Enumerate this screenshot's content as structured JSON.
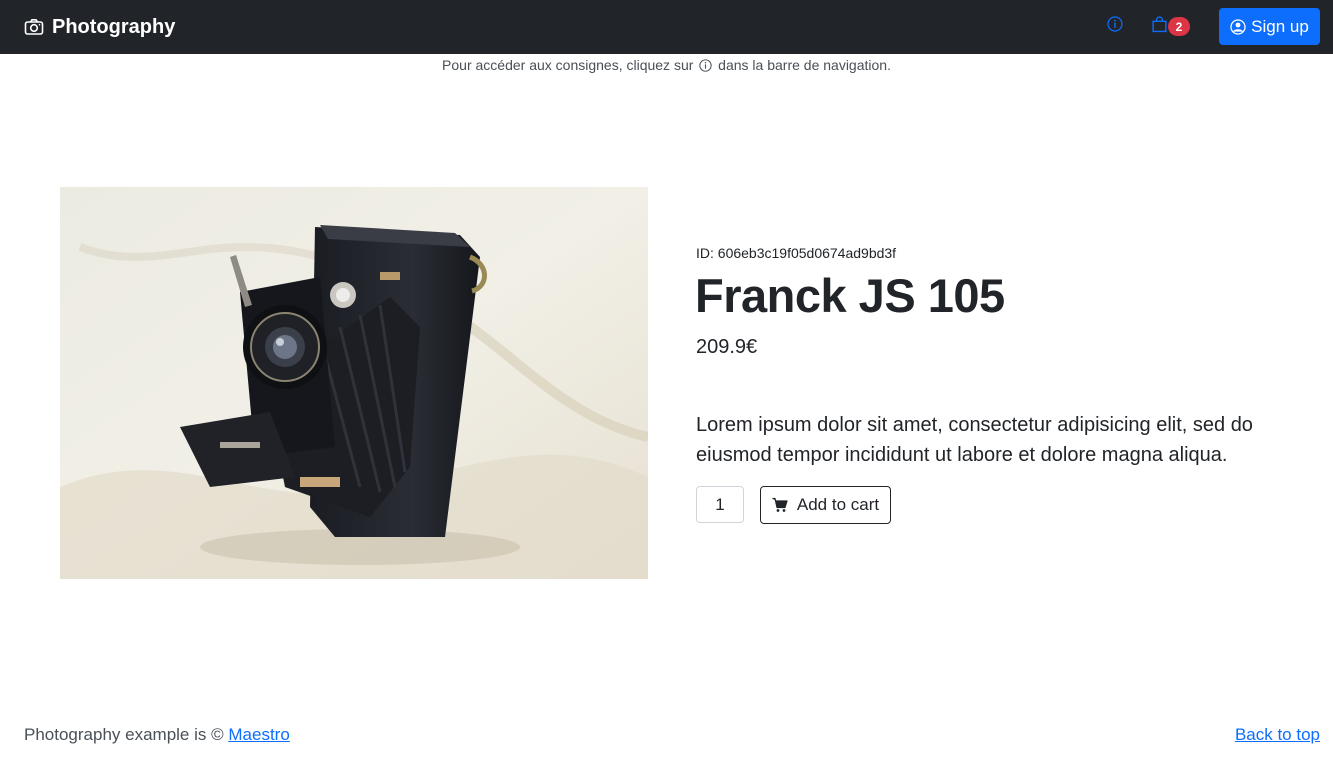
{
  "navbar": {
    "brand_text": "Photography",
    "cart_count": "2",
    "signup_label": "Sign up"
  },
  "notice": {
    "before": "Pour accéder aux consignes, cliquez sur",
    "after": "dans la barre de navigation."
  },
  "product": {
    "id_text": "ID: 606eb3c19f05d0674ad9bd3f",
    "title": "Franck JS 105",
    "price": "209.9€",
    "description": "Lorem ipsum dolor sit amet, consectetur adipisicing elit, sed do eiusmod tempor incididunt ut labore et dolore magna aliqua.",
    "quantity": "1",
    "add_to_cart_label": "Add to cart"
  },
  "footer": {
    "copyright": "Photography example is ©",
    "maestro_link": "Maestro",
    "back_to_top": "Back to top"
  },
  "colors": {
    "navbar_bg": "#212529",
    "primary": "#0d6efd",
    "badge": "#dc3545"
  },
  "icons": {
    "brand": "camera-icon",
    "info": "info-circle-icon",
    "cart": "bag-icon",
    "user": "person-circle-icon",
    "add_to_cart": "cart-icon"
  }
}
